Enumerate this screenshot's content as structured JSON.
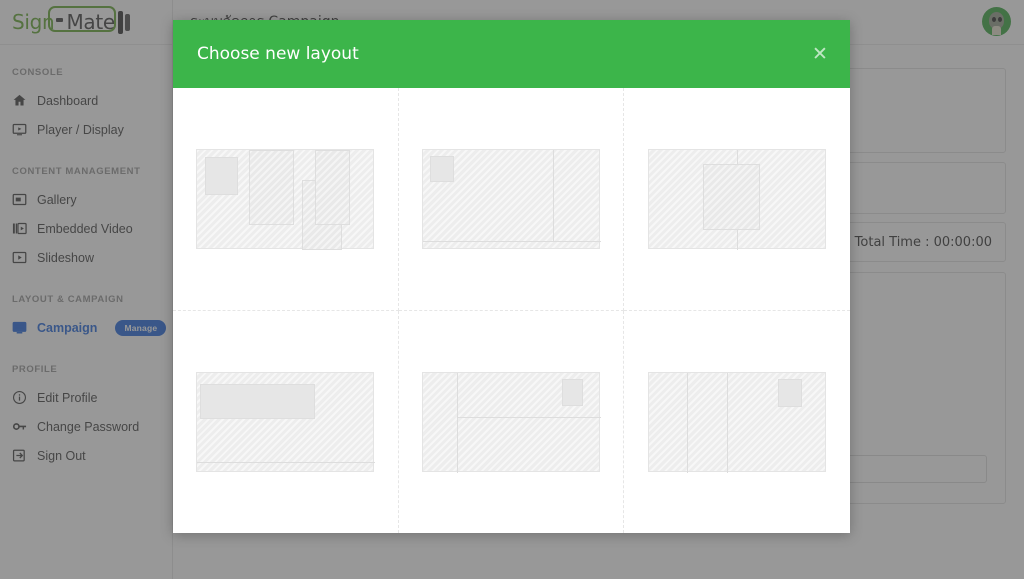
{
  "brand": {
    "name_part1": "Sign",
    "name_part2": "Mate",
    "icon": "signmate-logo"
  },
  "sidebar": {
    "groups": [
      {
        "title": "CONSOLE",
        "items": [
          {
            "label": "Dashboard",
            "icon": "home-icon",
            "active": false
          },
          {
            "label": "Player / Display",
            "icon": "monitor-play-icon",
            "active": false
          }
        ]
      },
      {
        "title": "CONTENT MANAGEMENT",
        "items": [
          {
            "label": "Gallery",
            "icon": "image-icon",
            "active": false
          },
          {
            "label": "Embedded Video",
            "icon": "video-layers-icon",
            "active": false
          },
          {
            "label": "Slideshow",
            "icon": "slideshow-icon",
            "active": false
          }
        ]
      },
      {
        "title": "LAYOUT & CAMPAIGN",
        "items": [
          {
            "label": "Campaign",
            "icon": "campaign-screen-icon",
            "active": true,
            "badge": "Manage"
          }
        ]
      },
      {
        "title": "PROFILE",
        "items": [
          {
            "label": "Edit Profile",
            "icon": "info-circle-icon",
            "active": false
          },
          {
            "label": "Change Password",
            "icon": "key-icon",
            "active": false
          },
          {
            "label": "Sign Out",
            "icon": "sign-out-icon",
            "active": false
          }
        ]
      }
    ]
  },
  "topbar": {
    "page_title": "ระบบจัดการ Campaign",
    "avatar_icon": "user-avatar"
  },
  "background_panels": {
    "total_time_label": "Total Time : 00:00:00"
  },
  "modal": {
    "title": "Choose new layout",
    "close_icon": "close-icon",
    "header_color": "#3cb54a",
    "layouts": [
      {
        "id": "layout-1",
        "name": "layout-option-1"
      },
      {
        "id": "layout-2",
        "name": "layout-option-2"
      },
      {
        "id": "layout-3",
        "name": "layout-option-3"
      },
      {
        "id": "layout-4",
        "name": "layout-option-4"
      },
      {
        "id": "layout-5",
        "name": "layout-option-5"
      },
      {
        "id": "layout-6",
        "name": "layout-option-6"
      }
    ]
  },
  "colors": {
    "brand_green": "#6aab3d",
    "modal_green": "#3cb54a",
    "active_blue": "#2f6fdd",
    "overlay": "rgba(68,68,68,.55)"
  }
}
